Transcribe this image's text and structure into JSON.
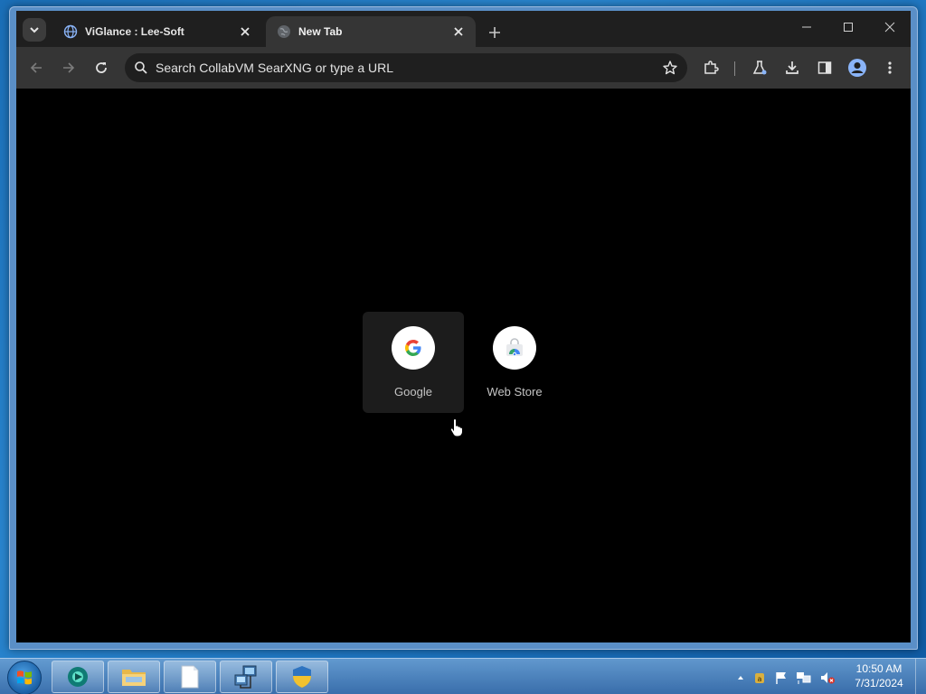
{
  "tabs": [
    {
      "title": "ViGlance : Lee-Soft",
      "active": false,
      "favicon": "globe-icon"
    },
    {
      "title": "New Tab",
      "active": true,
      "favicon": "globe-icon"
    }
  ],
  "omnibox": {
    "placeholder": "Search CollabVM SearXNG or type a URL"
  },
  "shortcuts": [
    {
      "label": "Google",
      "icon": "google-g-icon"
    },
    {
      "label": "Web Store",
      "icon": "web-store-icon"
    }
  ],
  "taskbar": {
    "pinned": [
      "viglance-icon",
      "folder-icon",
      "document-icon",
      "network-icon",
      "shield-icon"
    ],
    "clock": {
      "time": "10:50 AM",
      "date": "7/31/2024"
    }
  },
  "colors": {
    "tabstrip": "#1f1f1f",
    "toolbar": "#353535",
    "content_bg": "#000000",
    "accent": "#8ab4f8"
  }
}
